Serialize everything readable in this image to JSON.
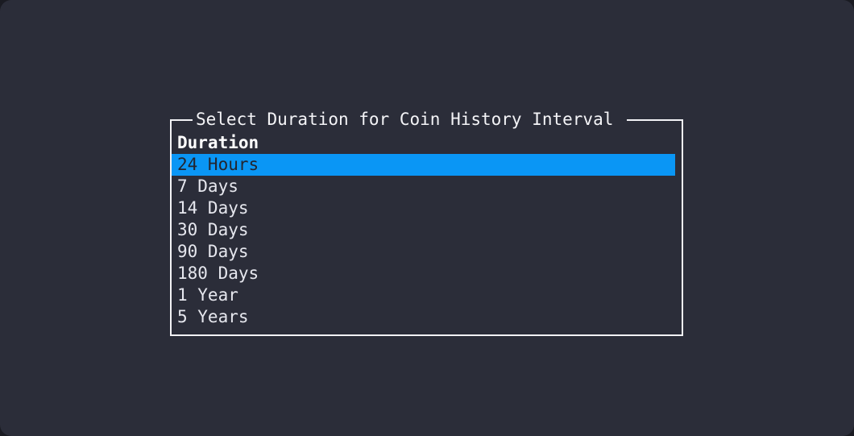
{
  "screen": {
    "background_color": "#2b2d39",
    "foreground_color": "#e6e7ee"
  },
  "dialog": {
    "title": "Select Duration for Coin History Interval",
    "border_color": "#f2f2f5",
    "column_header": "Duration",
    "selected_index": 0,
    "selected_value": "24 Hours",
    "highlight_color": "#0a96f5",
    "highlight_text_color": "#23252f",
    "options": [
      {
        "label": "24 Hours"
      },
      {
        "label": "7 Days"
      },
      {
        "label": "14 Days"
      },
      {
        "label": "30 Days"
      },
      {
        "label": "90 Days"
      },
      {
        "label": "180 Days"
      },
      {
        "label": "1 Year"
      },
      {
        "label": "5 Years"
      }
    ]
  }
}
